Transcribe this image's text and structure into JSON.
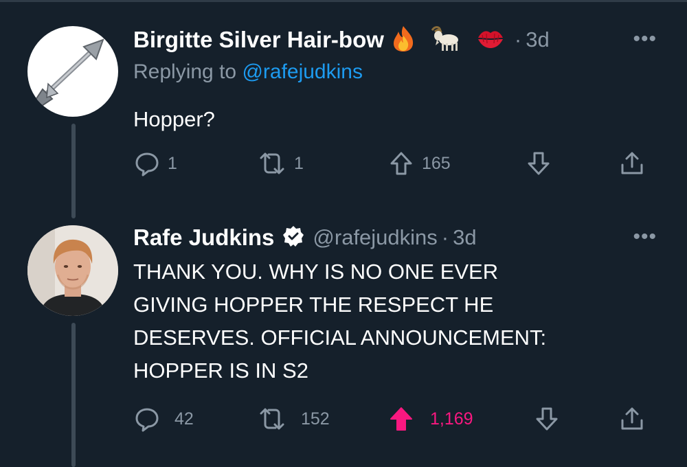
{
  "tweets": [
    {
      "author_name": "Birgitte Silver Hair-bow",
      "emoji": [
        "fire",
        "goat",
        "kiss-mark"
      ],
      "time": "3d",
      "replying_prefix": "Replying to",
      "replying_handle": "@rafejudkins",
      "text": "Hopper?",
      "replies": "1",
      "retweets": "1",
      "upvotes": "165",
      "more_label": "•••",
      "avatar_icon": "arrow-icon"
    },
    {
      "author_name": "Rafe Judkins",
      "verified": true,
      "handle": "@rafejudkins",
      "time": "3d",
      "text": "THANK YOU.  WHY IS NO ONE EVER\nGIVING HOPPER THE RESPECT HE\nDESERVES.  OFFICIAL ANNOUNCEMENT:\nHOPPER IS IN S2",
      "replies": "42",
      "retweets": "152",
      "upvotes": "1,169",
      "upvoted": true,
      "more_label": "•••",
      "avatar_icon": "person-photo"
    }
  ],
  "colors": {
    "background": "#15202b",
    "secondary_text": "#8b98a5",
    "link": "#1d9bf0",
    "upvote_active": "#f91880",
    "thread_line": "#3d4a56"
  },
  "separator": "·"
}
